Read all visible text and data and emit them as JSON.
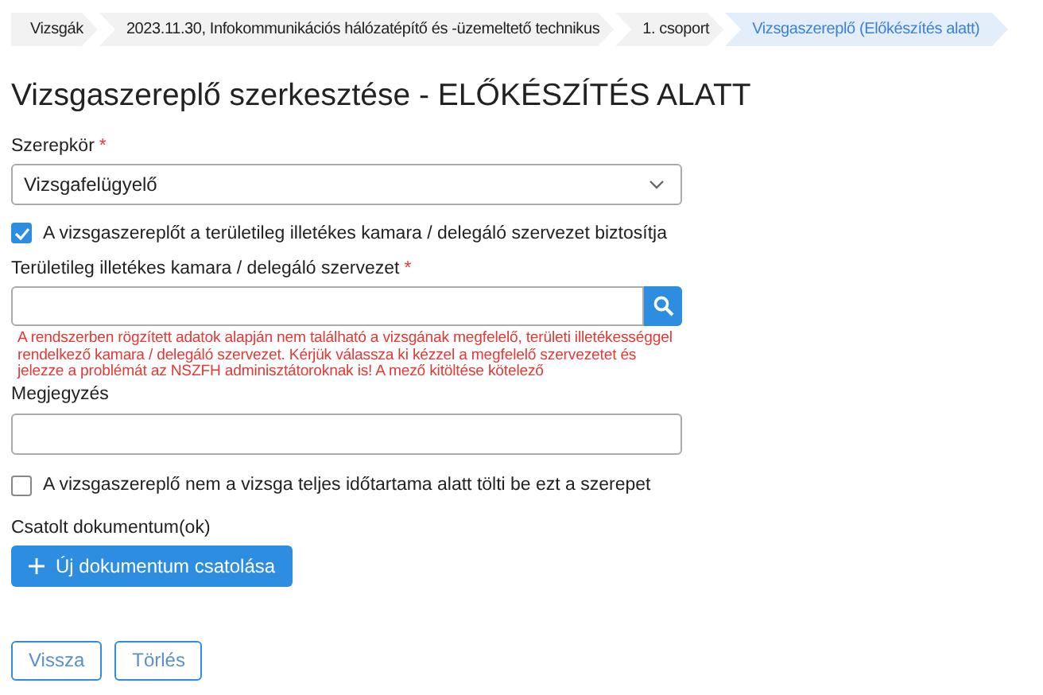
{
  "breadcrumb": [
    {
      "label": "Vizsgák",
      "selected": false
    },
    {
      "label": "2023.11.30, Infokommunikációs hálózatépítő és -üzemeltető technikus",
      "selected": false
    },
    {
      "label": "1. csoport",
      "selected": false
    },
    {
      "label": "Vizsgaszereplő (Előkészítés alatt)",
      "selected": true
    }
  ],
  "title": "Vizsgaszereplő szerkesztése - ELŐKÉSZÍTÉS ALATT",
  "role": {
    "label": "Szerepkör",
    "required_mark": "*",
    "value": "Vizsgafelügyelő"
  },
  "provided_checkbox": {
    "label": "A vizsgaszereplőt a területileg illetékes kamara / delegáló szervezet biztosítja",
    "checked": true
  },
  "organization": {
    "label": "Területileg illetékes kamara / delegáló szervezet",
    "required_mark": "*",
    "error": "A rendszerben rögzített adatok alapján nem található a vizsgának megfelelő, területi illetékességgel rendelkező kamara / delegáló szervezet. Kérjük válassza ki kézzel a megfelelő szervezetet és jelezze a problémát az NSZFH adminisztátoroknak is! A mező kitöltése kötelező"
  },
  "note": {
    "label": "Megjegyzés"
  },
  "partial_checkbox": {
    "label": "A vizsgaszereplő nem a vizsga teljes időtartama alatt tölti be ezt a szerepet",
    "checked": false
  },
  "attachments": {
    "label": "Csatolt dokumentum(ok)",
    "button": "Új dokumentum csatolása"
  },
  "buttons": [
    "Vissza",
    "Törlés"
  ]
}
